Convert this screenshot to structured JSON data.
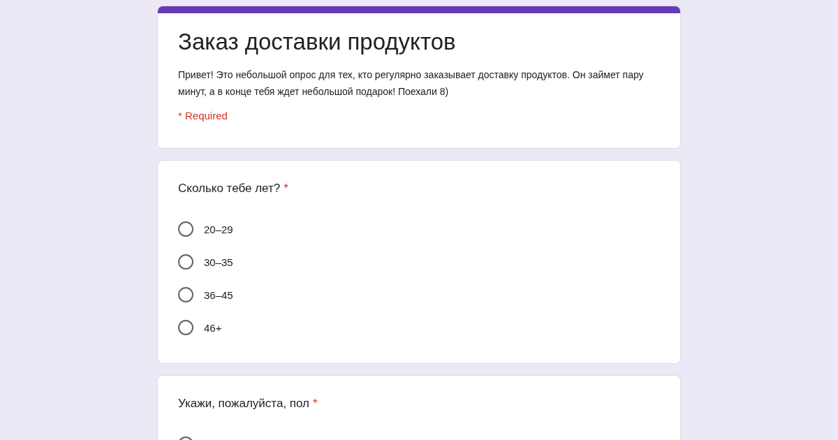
{
  "form": {
    "title": "Заказ доставки продуктов",
    "description": "Привет! Это небольшой опрос для тех, кто регулярно заказывает доставку продуктов. Он займет пару минут, а в конце тебя ждет небольшой подарок! Поехали 8)",
    "required_note": "* Required"
  },
  "questions": [
    {
      "title": "Сколько тебе лет?",
      "required_mark": "*",
      "options": [
        {
          "label": "20–29",
          "selected": false
        },
        {
          "label": "30–35",
          "selected": false
        },
        {
          "label": "36–45",
          "selected": false
        },
        {
          "label": "46+",
          "selected": false
        }
      ]
    },
    {
      "title": "Укажи, пожалуйста, пол",
      "required_mark": "*",
      "options": [
        {
          "selected": false
        }
      ]
    }
  ]
}
